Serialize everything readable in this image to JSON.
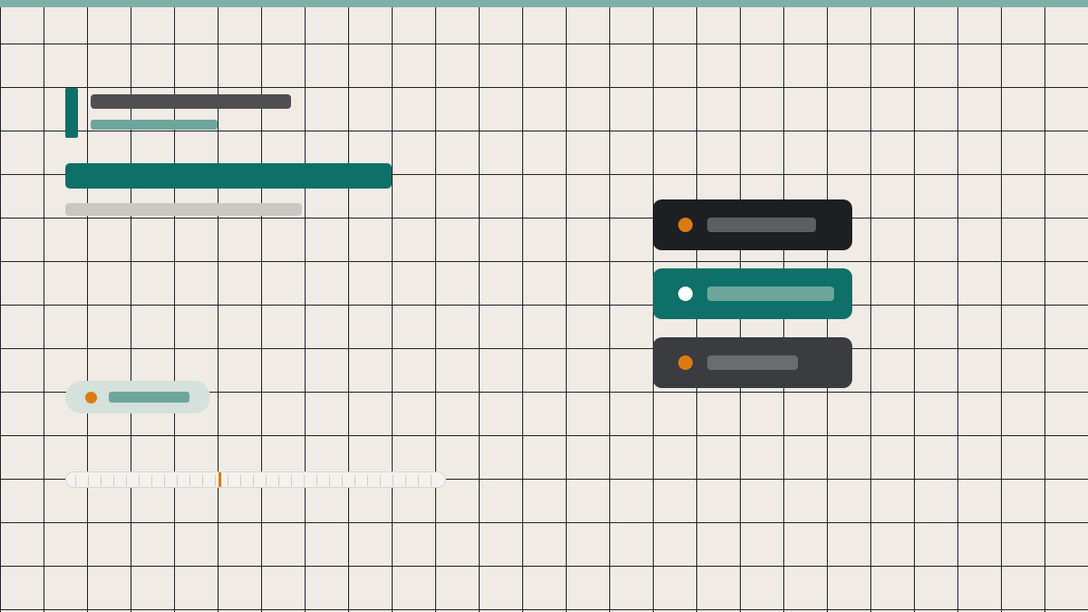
{
  "colors": {
    "background": "#f0ece5",
    "grid_line": "#1d1f22",
    "top_band": "#7fb0a6",
    "accent": "#0e7068",
    "accent_light": "#6ea69c",
    "highlight": "#dc7a12",
    "dark": "#1d1f22",
    "charcoal": "#3a3c3f",
    "text_placeholder": "#4f4f51",
    "muted": "#cbc8c2"
  },
  "icons": {
    "status_dot": "orange-dot-icon",
    "menu_dot": "dot-icon"
  },
  "slider": {
    "value_fraction": 0.4
  },
  "menu": {
    "selected_index": 1
  }
}
